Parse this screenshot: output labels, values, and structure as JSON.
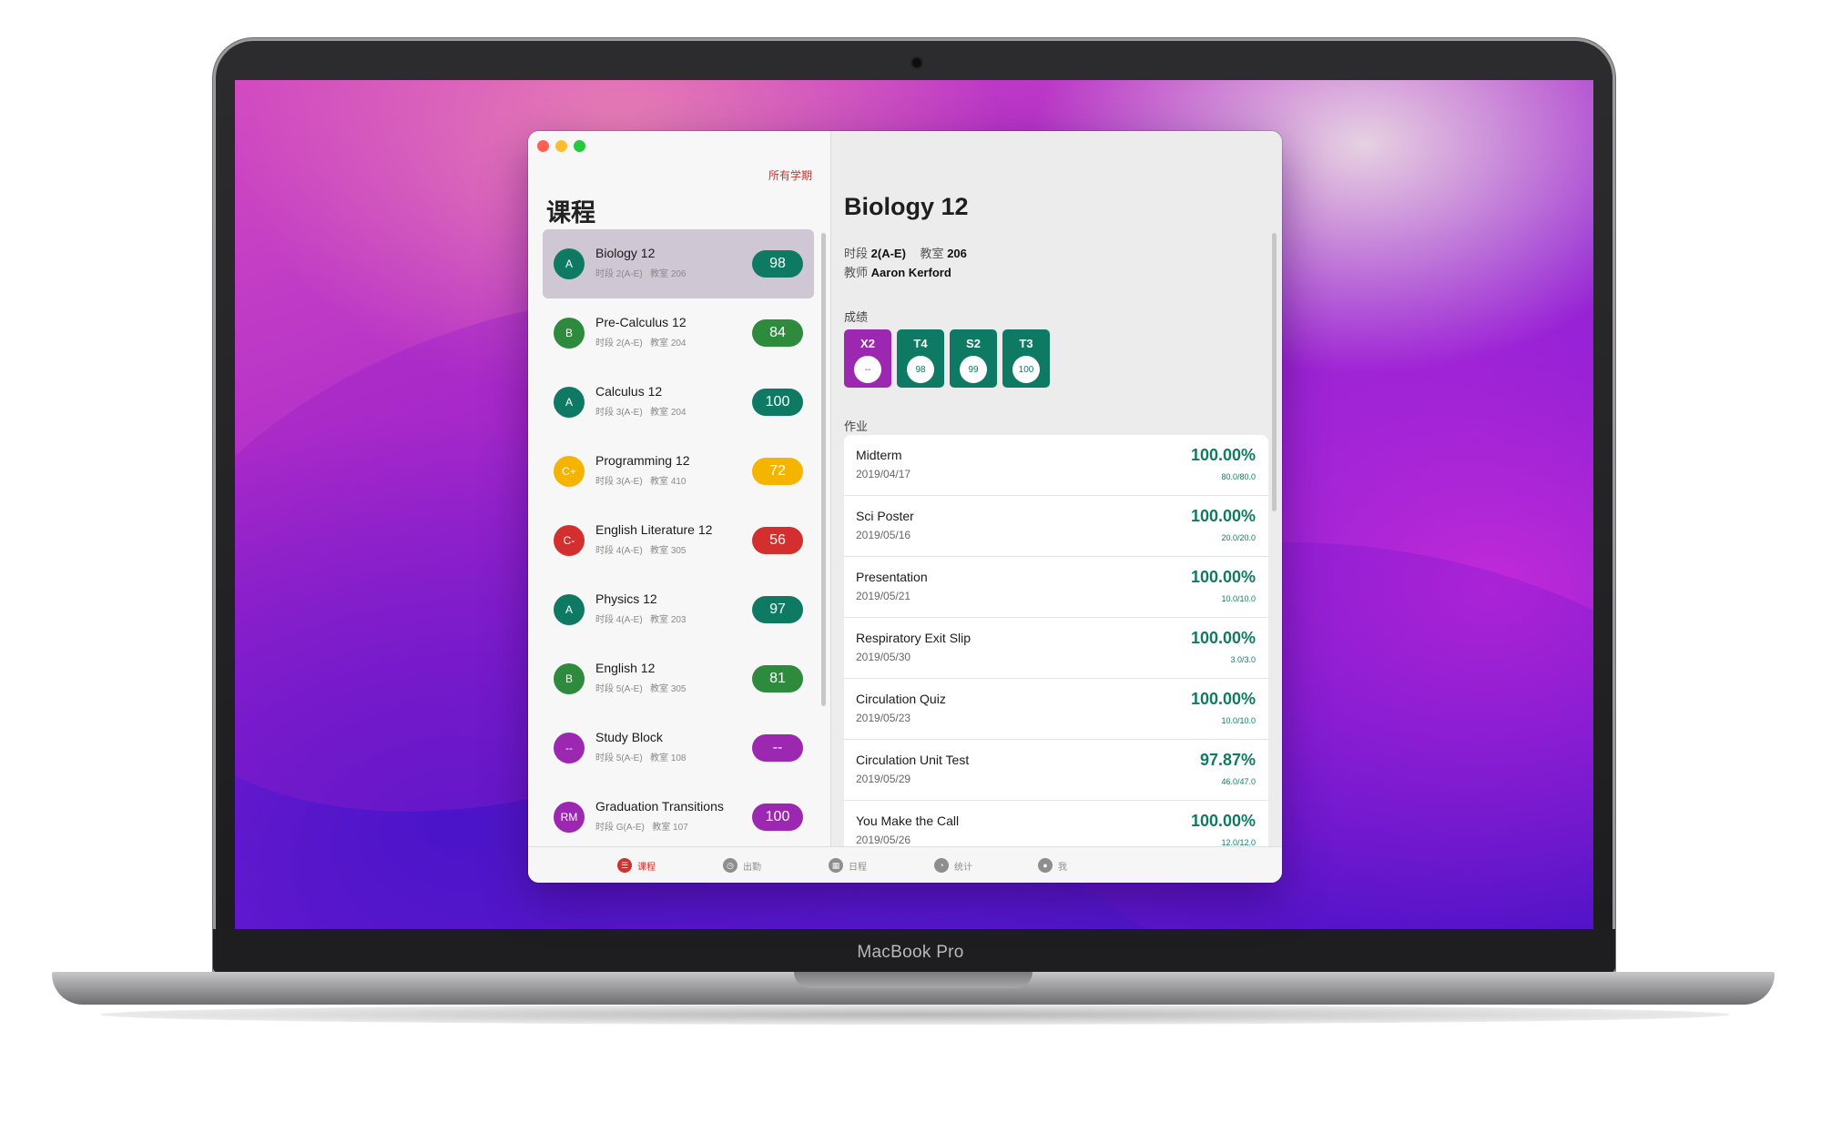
{
  "device_label": "MacBook Pro",
  "colors": {
    "accent": "#d0312d",
    "grade_teal": "#0f7a63",
    "grade_green": "#2e8b3e",
    "grade_amber": "#f5b400",
    "grade_red": "#d32f2f",
    "grade_purple": "#9c27b0"
  },
  "sidebar": {
    "semester_link": "所有学期",
    "title": "课程",
    "courses": [
      {
        "name": "Biology 12",
        "period_label": "时段",
        "period": "2(A-E)",
        "room_label": "教室",
        "room": "206",
        "letter": "A",
        "score": "98",
        "color": "#0f7a63",
        "selected": true
      },
      {
        "name": "Pre-Calculus 12",
        "period_label": "时段",
        "period": "2(A-E)",
        "room_label": "教室",
        "room": "204",
        "letter": "B",
        "score": "84",
        "color": "#2e8b3e"
      },
      {
        "name": "Calculus 12",
        "period_label": "时段",
        "period": "3(A-E)",
        "room_label": "教室",
        "room": "204",
        "letter": "A",
        "score": "100",
        "color": "#0f7a63"
      },
      {
        "name": "Programming 12",
        "period_label": "时段",
        "period": "3(A-E)",
        "room_label": "教室",
        "room": "410",
        "letter": "C+",
        "score": "72",
        "color": "#f5b400"
      },
      {
        "name": "English Literature 12",
        "period_label": "时段",
        "period": "4(A-E)",
        "room_label": "教室",
        "room": "305",
        "letter": "C-",
        "score": "56",
        "color": "#d32f2f"
      },
      {
        "name": "Physics 12",
        "period_label": "时段",
        "period": "4(A-E)",
        "room_label": "教室",
        "room": "203",
        "letter": "A",
        "score": "97",
        "color": "#0f7a63"
      },
      {
        "name": "English 12",
        "period_label": "时段",
        "period": "5(A-E)",
        "room_label": "教室",
        "room": "305",
        "letter": "B",
        "score": "81",
        "color": "#2e8b3e"
      },
      {
        "name": "Study Block",
        "period_label": "时段",
        "period": "5(A-E)",
        "room_label": "教室",
        "room": "108",
        "letter": "--",
        "score": "--",
        "color": "#9c27b0"
      },
      {
        "name": "Graduation Transitions",
        "period_label": "时段",
        "period": "G(A-E)",
        "room_label": "教室",
        "room": "107",
        "letter": "RM",
        "score": "100",
        "color": "#9c27b0"
      }
    ]
  },
  "detail": {
    "title": "Biology 12",
    "period_label": "时段",
    "period": "2(A-E)",
    "room_label": "教室",
    "room": "206",
    "teacher_label": "教师",
    "teacher": "Aaron Kerford",
    "grades_label": "成绩",
    "terms": [
      {
        "code": "X2",
        "value": "--",
        "color": "#9c27b0"
      },
      {
        "code": "T4",
        "value": "98",
        "color": "#0f7a63"
      },
      {
        "code": "S2",
        "value": "99",
        "color": "#0f7a63"
      },
      {
        "code": "T3",
        "value": "100",
        "color": "#0f7a63"
      }
    ],
    "assignments_label": "作业",
    "assignments": [
      {
        "name": "Midterm",
        "date": "2019/04/17",
        "percent": "100.00%",
        "points": "80.0/80.0"
      },
      {
        "name": "Sci Poster",
        "date": "2019/05/16",
        "percent": "100.00%",
        "points": "20.0/20.0"
      },
      {
        "name": "Presentation",
        "date": "2019/05/21",
        "percent": "100.00%",
        "points": "10.0/10.0"
      },
      {
        "name": "Respiratory Exit Slip",
        "date": "2019/05/30",
        "percent": "100.00%",
        "points": "3.0/3.0"
      },
      {
        "name": "Circulation Quiz",
        "date": "2019/05/23",
        "percent": "100.00%",
        "points": "10.0/10.0"
      },
      {
        "name": "Circulation Unit Test",
        "date": "2019/05/29",
        "percent": "97.87%",
        "points": "46.0/47.0"
      },
      {
        "name": "You Make the Call",
        "date": "2019/05/26",
        "percent": "100.00%",
        "points": "12.0/12.0"
      }
    ]
  },
  "tabbar": {
    "tabs": [
      {
        "label": "课程",
        "icon": "list-icon",
        "active": true
      },
      {
        "label": "出勤",
        "icon": "clock-icon"
      },
      {
        "label": "日程",
        "icon": "calendar-icon"
      },
      {
        "label": "统计",
        "icon": "pie-chart-icon"
      },
      {
        "label": "我",
        "icon": "person-icon"
      }
    ]
  }
}
